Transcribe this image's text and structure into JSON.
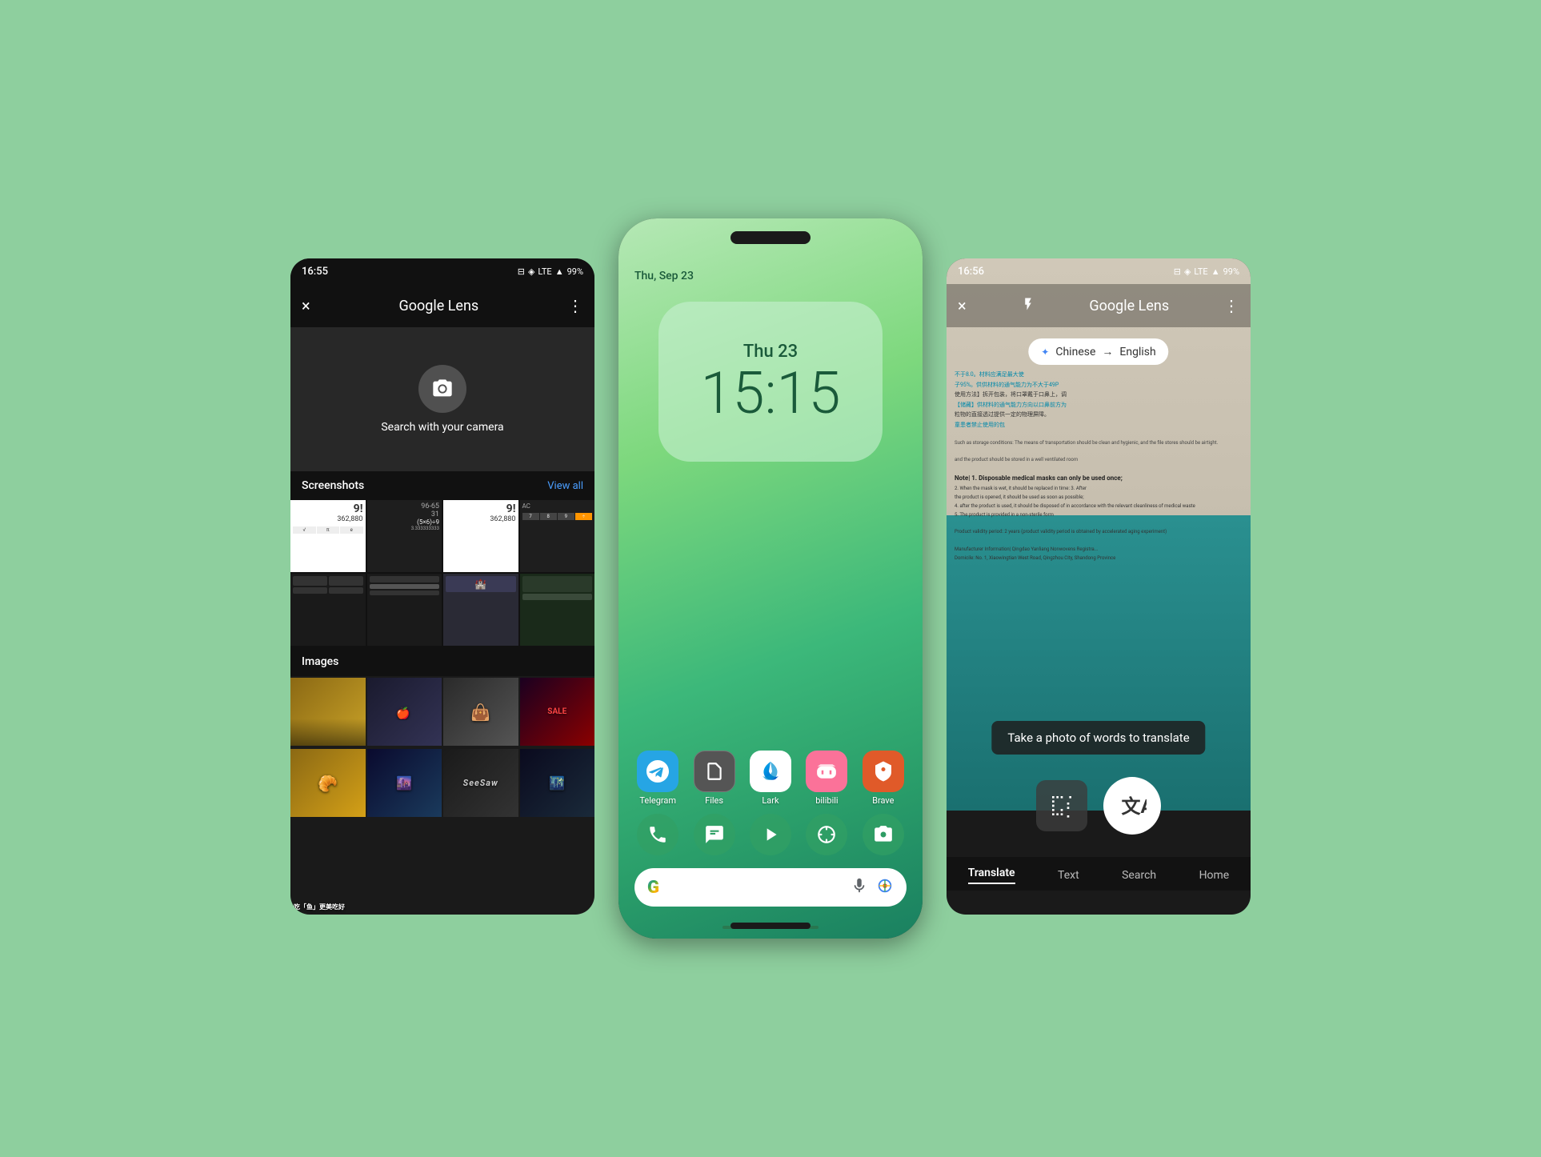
{
  "background_color": "#8ecf9e",
  "left_phone": {
    "status_bar": {
      "time": "16:55",
      "signal_icon": "signal",
      "network": "LTE",
      "battery": "99%"
    },
    "header": {
      "close_label": "×",
      "title": "Google Lens",
      "more_label": "⋮"
    },
    "camera": {
      "label": "Search with your camera"
    },
    "screenshots": {
      "title": "Screenshots",
      "view_all": "View all"
    },
    "images": {
      "title": "Images"
    }
  },
  "center_phone": {
    "date": "Thu, Sep 23",
    "clock_day": "Thu 23",
    "clock_time": "15:15",
    "apps": [
      {
        "name": "Telegram",
        "icon": "telegram"
      },
      {
        "name": "Files",
        "icon": "files"
      },
      {
        "name": "Lark",
        "icon": "lark"
      },
      {
        "name": "bilibili",
        "icon": "bilibili"
      },
      {
        "name": "Brave",
        "icon": "brave"
      }
    ],
    "dock": [
      {
        "name": "phone",
        "icon": "📞"
      },
      {
        "name": "messages",
        "icon": "💬"
      },
      {
        "name": "play",
        "icon": "▶"
      },
      {
        "name": "pinwheel",
        "icon": "✿"
      },
      {
        "name": "camera",
        "icon": "📷"
      }
    ],
    "search_bar": {
      "g_logo": "G",
      "mic_icon": "🎤",
      "lens_icon": "🔍"
    }
  },
  "right_phone": {
    "status_bar": {
      "time": "16:56",
      "network": "LTE",
      "battery": "99%"
    },
    "header": {
      "close_label": "×",
      "flash_label": "⚡",
      "title": "Google Lens",
      "more_label": "⋮"
    },
    "translate_chip": {
      "source_lang": "Chinese",
      "target_lang": "English",
      "star": "✦"
    },
    "translate_prompt": "Take a photo of words to translate",
    "bottom_tabs": {
      "translate": "Translate",
      "text": "Text",
      "search": "Search",
      "home": "Home"
    },
    "active_tab": "Translate"
  }
}
